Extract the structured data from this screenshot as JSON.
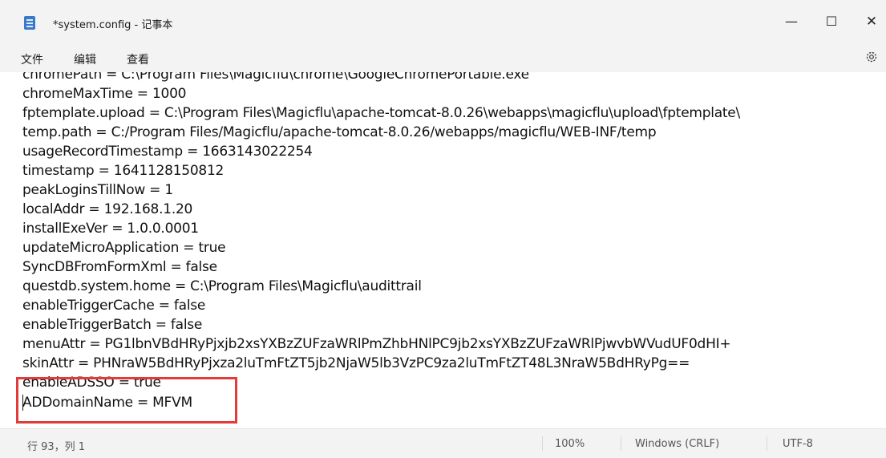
{
  "window": {
    "title": "*system.config - 记事本",
    "minimize": "—",
    "maximize": "☐",
    "close": "✕"
  },
  "menu": {
    "items": [
      "文件",
      "编辑",
      "查看"
    ],
    "settings_icon": "gear-icon"
  },
  "editor": {
    "lines": [
      "chromePath = C:\\Program Files\\Magicflu\\chrome\\GoogleChromePortable.exe",
      "chromeMaxTime = 1000",
      "fptemplate.upload = C:\\Program Files\\Magicflu\\apache-tomcat-8.0.26\\webapps\\magicflu\\upload\\fptemplate\\",
      "temp.path = C:/Program Files/Magicflu/apache-tomcat-8.0.26/webapps/magicflu/WEB-INF/temp",
      "usageRecordTimestamp = 1663143022254",
      "timestamp = 1641128150812",
      "peakLoginsTillNow = 1",
      "localAddr = 192.168.1.20",
      "installExeVer = 1.0.0.0001",
      "updateMicroApplication = true",
      "SyncDBFromFormXml = false",
      "questdb.system.home = C:\\Program Files\\Magicflu\\audittrail",
      "enableTriggerCache = false",
      "enableTriggerBatch = false",
      "menuAttr = PG1lbnVBdHRyPjxjb2xsYXBzZUFzaWRlPmZhbHNlPC9jb2xsYXBzZUFzaWRlPjwvbWVudUF0dHI+",
      "skinAttr = PHNraW5BdHRyPjxza2luTmFtZT5jb2NjaW5lb3VzPC9za2luTmFtZT48L3NraW5BdHRyPg==",
      "enableADSSO = true",
      "ADDomainName = MFVM"
    ],
    "highlight_color": "#e23b3b"
  },
  "status": {
    "position": "行 93，列 1",
    "zoom": "100%",
    "line_ending": "Windows (CRLF)",
    "encoding": "UTF-8"
  }
}
